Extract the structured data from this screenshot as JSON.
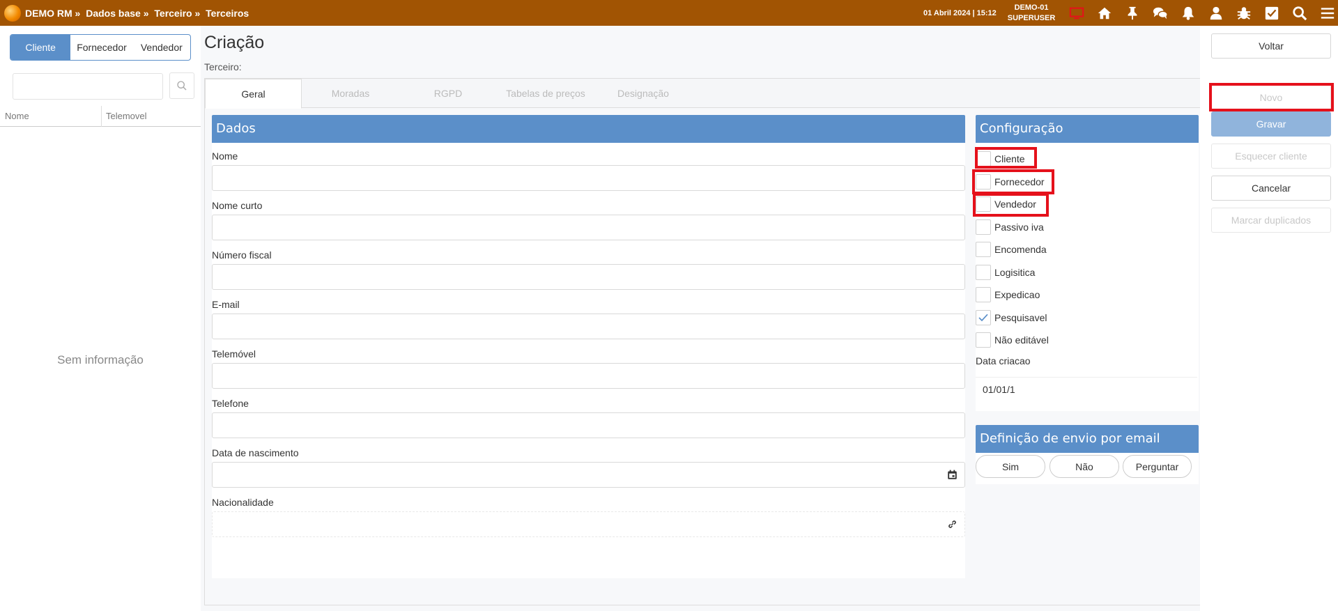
{
  "topbar": {
    "breadcrumb": [
      "DEMO RM »",
      "Dados base »",
      "Terceiro »",
      "Terceiros"
    ],
    "datetime": "01 Abril 2024 | 15:12",
    "company": "DEMO-01",
    "user": "SUPERUSER",
    "icons": [
      "monitor-icon",
      "home-icon",
      "pin-icon",
      "chat-icon",
      "bell-icon",
      "user-icon",
      "bug-icon",
      "checkbox-icon",
      "search-icon",
      "menu-icon"
    ],
    "accent_color": "#a15403",
    "monitor_color": "#e5111b"
  },
  "left": {
    "segments": [
      "Cliente",
      "Fornecedor",
      "Vendedor"
    ],
    "active_segment": "Cliente",
    "search_placeholder": "",
    "columns": [
      "Nome",
      "Telemovel"
    ],
    "empty_text": "Sem informação"
  },
  "main": {
    "title": "Criação",
    "subtitle": "Terceiro:",
    "tabs": [
      "Geral",
      "Moradas",
      "RGPD",
      "Tabelas de preços",
      "Designação"
    ],
    "active_tab": "Geral",
    "dados": {
      "header": "Dados",
      "fields": [
        {
          "label": "Nome",
          "value": ""
        },
        {
          "label": "Nome curto",
          "value": ""
        },
        {
          "label": "Número fiscal",
          "value": ""
        },
        {
          "label": "E-mail",
          "value": ""
        },
        {
          "label": "Telemóvel",
          "value": ""
        },
        {
          "label": "Telefone",
          "value": ""
        },
        {
          "label": "Data de nascimento",
          "value": ""
        },
        {
          "label": "Nacionalidade",
          "value": ""
        }
      ]
    },
    "config": {
      "header": "Configuração",
      "checkboxes": [
        {
          "label": "Cliente",
          "checked": false
        },
        {
          "label": "Fornecedor",
          "checked": false
        },
        {
          "label": "Vendedor",
          "checked": false
        },
        {
          "label": "Passivo iva",
          "checked": false
        },
        {
          "label": "Encomenda",
          "checked": false
        },
        {
          "label": "Logisitica",
          "checked": false
        },
        {
          "label": "Expedicao",
          "checked": false
        },
        {
          "label": "Pesquisavel",
          "checked": true
        },
        {
          "label": "Não editável",
          "checked": false
        }
      ],
      "date_label": "Data criacao",
      "date_value": "01/01/1"
    },
    "email_def": {
      "header": "Definição de envio por email",
      "options": [
        "Sim",
        "Não",
        "Perguntar"
      ]
    },
    "header_color": "#5b8fc9"
  },
  "right": {
    "buttons": [
      {
        "label": "Voltar",
        "state": "enabled"
      },
      {
        "label": "Novo",
        "state": "disabled"
      },
      {
        "label": "Gravar",
        "state": "primary-disabled"
      },
      {
        "label": "Esquecer cliente",
        "state": "disabled"
      },
      {
        "label": "Cancelar",
        "state": "enabled"
      },
      {
        "label": "Marcar duplicados",
        "state": "disabled"
      }
    ]
  },
  "highlight_color": "#e5111b"
}
